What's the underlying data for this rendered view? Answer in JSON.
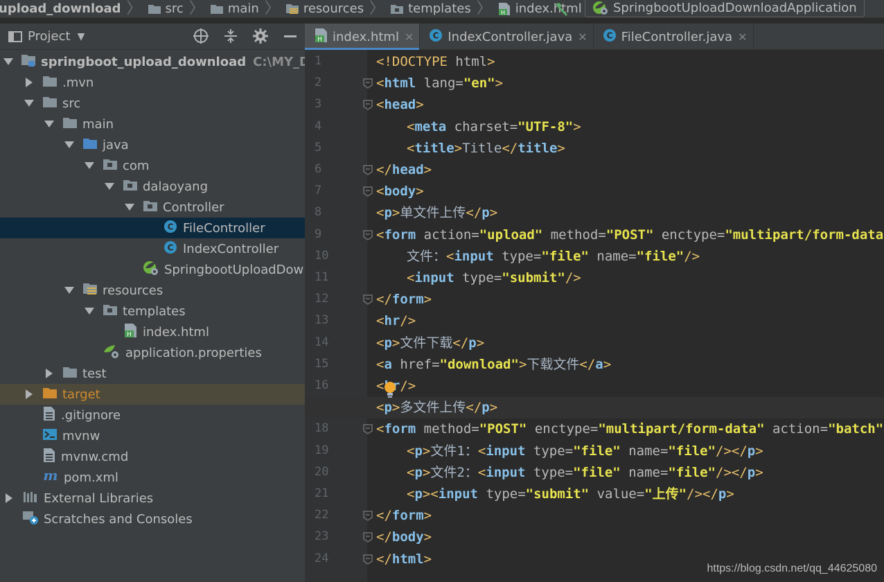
{
  "navbar": {
    "crumbs": [
      "upload_download",
      "src",
      "main",
      "resources",
      "templates",
      "index.html"
    ],
    "run_config": "SpringbootUploadDownloadApplication"
  },
  "project": {
    "title": "Project",
    "tree": [
      {
        "label": "springboot_upload_download",
        "hint": "C:\\MY_DA",
        "icon": "module-folder-icon",
        "arrow": "down"
      },
      {
        "label": ".mvn",
        "icon": "folder-icon",
        "arrow": "right"
      },
      {
        "label": "src",
        "icon": "folder-icon",
        "arrow": "down"
      },
      {
        "label": "main",
        "icon": "folder-icon",
        "arrow": "down"
      },
      {
        "label": "java",
        "icon": "source-folder-icon",
        "arrow": "down"
      },
      {
        "label": "com",
        "icon": "package-icon",
        "arrow": "down"
      },
      {
        "label": "dalaoyang",
        "icon": "package-icon",
        "arrow": "down"
      },
      {
        "label": "Controller",
        "icon": "package-icon",
        "arrow": "down"
      },
      {
        "label": "FileController",
        "icon": "class-icon",
        "selected": true
      },
      {
        "label": "IndexController",
        "icon": "class-icon"
      },
      {
        "label": "SpringbootUploadDow",
        "icon": "spring-boot-app-icon"
      },
      {
        "label": "resources",
        "icon": "resources-folder-icon",
        "arrow": "down"
      },
      {
        "label": "templates",
        "icon": "package-icon",
        "arrow": "down"
      },
      {
        "label": "index.html",
        "icon": "html-file-icon"
      },
      {
        "label": "application.properties",
        "icon": "spring-properties-icon"
      },
      {
        "label": "test",
        "icon": "folder-icon",
        "arrow": "right"
      },
      {
        "label": "target",
        "icon": "excluded-folder-icon",
        "arrow": "right",
        "excluded": true
      },
      {
        "label": ".gitignore",
        "icon": "text-file-icon"
      },
      {
        "label": "mvnw",
        "icon": "shell-script-icon"
      },
      {
        "label": "mvnw.cmd",
        "icon": "text-file-icon"
      },
      {
        "label": "pom.xml",
        "icon": "maven-icon"
      },
      {
        "label": "External Libraries",
        "icon": "libraries-icon",
        "arrow": "right"
      },
      {
        "label": "Scratches and Consoles",
        "icon": "scratches-icon"
      }
    ]
  },
  "tabs": [
    {
      "label": "index.html",
      "icon": "html-file-icon",
      "active": true
    },
    {
      "label": "IndexController.java",
      "icon": "class-icon"
    },
    {
      "label": "FileController.java",
      "icon": "class-icon"
    }
  ],
  "editor": {
    "current_line": 17,
    "lines": [
      {
        "n": "1",
        "tokens": [
          [
            "doctype",
            "<!DOCTYPE"
          ],
          [
            "attr",
            " html"
          ],
          [
            "doctype",
            ">"
          ]
        ]
      },
      {
        "n": "2",
        "fold": true,
        "tokens": [
          [
            "tag",
            "<"
          ],
          [
            "name",
            "html"
          ],
          [
            "attr",
            " lang="
          ],
          [
            "str",
            "\"en\""
          ],
          [
            "tag",
            ">"
          ]
        ]
      },
      {
        "n": "3",
        "fold": true,
        "tokens": [
          [
            "tag",
            "<"
          ],
          [
            "name",
            "head"
          ],
          [
            "tag",
            ">"
          ]
        ]
      },
      {
        "n": "4",
        "indent": 1,
        "tokens": [
          [
            "tag",
            "<"
          ],
          [
            "name",
            "meta"
          ],
          [
            "attr",
            " charset="
          ],
          [
            "str",
            "\"UTF-8\""
          ],
          [
            "tag",
            ">"
          ]
        ]
      },
      {
        "n": "5",
        "indent": 1,
        "tokens": [
          [
            "tag",
            "<"
          ],
          [
            "name",
            "title"
          ],
          [
            "tag",
            ">"
          ],
          [
            "text",
            "Title"
          ],
          [
            "tag",
            "</"
          ],
          [
            "name",
            "title"
          ],
          [
            "tag",
            ">"
          ]
        ]
      },
      {
        "n": "6",
        "fold": true,
        "tokens": [
          [
            "tag",
            "</"
          ],
          [
            "name",
            "head"
          ],
          [
            "tag",
            ">"
          ]
        ]
      },
      {
        "n": "7",
        "fold": true,
        "tokens": [
          [
            "tag",
            "<"
          ],
          [
            "name",
            "body"
          ],
          [
            "tag",
            ">"
          ]
        ]
      },
      {
        "n": "8",
        "tokens": [
          [
            "tag",
            "<"
          ],
          [
            "name",
            "p"
          ],
          [
            "tag",
            ">"
          ],
          [
            "text",
            "单文件上传"
          ],
          [
            "tag",
            "</"
          ],
          [
            "name",
            "p"
          ],
          [
            "tag",
            ">"
          ]
        ]
      },
      {
        "n": "9",
        "fold": true,
        "tokens": [
          [
            "tag",
            "<"
          ],
          [
            "name",
            "form"
          ],
          [
            "attr",
            " action="
          ],
          [
            "str",
            "\"upload\""
          ],
          [
            "attr",
            " method="
          ],
          [
            "str",
            "\"POST\""
          ],
          [
            "attr",
            " enctype="
          ],
          [
            "str",
            "\"multipart/form-data\""
          ],
          [
            "tag",
            ">"
          ]
        ]
      },
      {
        "n": "10",
        "indent": 1,
        "tokens": [
          [
            "text",
            "文件："
          ],
          [
            "tag",
            "<"
          ],
          [
            "name",
            "input"
          ],
          [
            "attr",
            " type="
          ],
          [
            "str",
            "\"file\""
          ],
          [
            "attr",
            " name="
          ],
          [
            "str",
            "\"file\""
          ],
          [
            "tag",
            "/>"
          ]
        ]
      },
      {
        "n": "11",
        "indent": 1,
        "tokens": [
          [
            "tag",
            "<"
          ],
          [
            "name",
            "input"
          ],
          [
            "attr",
            " type="
          ],
          [
            "str",
            "\"submit\""
          ],
          [
            "tag",
            "/>"
          ]
        ]
      },
      {
        "n": "12",
        "fold": true,
        "tokens": [
          [
            "tag",
            "</"
          ],
          [
            "name",
            "form"
          ],
          [
            "tag",
            ">"
          ]
        ]
      },
      {
        "n": "13",
        "tokens": [
          [
            "tag",
            "<"
          ],
          [
            "name",
            "hr"
          ],
          [
            "tag",
            "/>"
          ]
        ]
      },
      {
        "n": "14",
        "tokens": [
          [
            "tag",
            "<"
          ],
          [
            "name",
            "p"
          ],
          [
            "tag",
            ">"
          ],
          [
            "text",
            "文件下载"
          ],
          [
            "tag",
            "</"
          ],
          [
            "name",
            "p"
          ],
          [
            "tag",
            ">"
          ]
        ]
      },
      {
        "n": "15",
        "tokens": [
          [
            "tag",
            "<"
          ],
          [
            "name",
            "a"
          ],
          [
            "attr",
            " href="
          ],
          [
            "str",
            "\"download\""
          ],
          [
            "tag",
            ">"
          ],
          [
            "text",
            "下载文件"
          ],
          [
            "tag",
            "</"
          ],
          [
            "name",
            "a"
          ],
          [
            "tag",
            ">"
          ]
        ]
      },
      {
        "n": "16",
        "tokens": [
          [
            "tag",
            "<"
          ],
          [
            "name",
            "hr"
          ],
          [
            "tag",
            "/>"
          ]
        ]
      },
      {
        "n": "",
        "tokens": [
          [
            "tag",
            "<"
          ],
          [
            "name",
            "p"
          ],
          [
            "tag",
            ">"
          ],
          [
            "text",
            "多文件上传"
          ],
          [
            "tag",
            "</"
          ],
          [
            "name",
            "p"
          ],
          [
            "tag",
            ">"
          ]
        ]
      },
      {
        "n": "18",
        "fold": true,
        "tokens": [
          [
            "tag",
            "<"
          ],
          [
            "name",
            "form"
          ],
          [
            "attr",
            " method="
          ],
          [
            "str",
            "\"POST\""
          ],
          [
            "attr",
            " enctype="
          ],
          [
            "str",
            "\"multipart/form-data\""
          ],
          [
            "attr",
            " action="
          ],
          [
            "str",
            "\"batch\""
          ],
          [
            "tag",
            ">"
          ]
        ]
      },
      {
        "n": "19",
        "indent": 1,
        "tokens": [
          [
            "tag",
            "<"
          ],
          [
            "name",
            "p"
          ],
          [
            "tag",
            ">"
          ],
          [
            "text",
            "文件1："
          ],
          [
            "tag",
            "<"
          ],
          [
            "name",
            "input"
          ],
          [
            "attr",
            " type="
          ],
          [
            "str",
            "\"file\""
          ],
          [
            "attr",
            " name="
          ],
          [
            "str",
            "\"file\""
          ],
          [
            "tag",
            "/></"
          ],
          [
            "name",
            "p"
          ],
          [
            "tag",
            ">"
          ]
        ]
      },
      {
        "n": "20",
        "indent": 1,
        "tokens": [
          [
            "tag",
            "<"
          ],
          [
            "name",
            "p"
          ],
          [
            "tag",
            ">"
          ],
          [
            "text",
            "文件2："
          ],
          [
            "tag",
            "<"
          ],
          [
            "name",
            "input"
          ],
          [
            "attr",
            " type="
          ],
          [
            "str",
            "\"file\""
          ],
          [
            "attr",
            " name="
          ],
          [
            "str",
            "\"file\""
          ],
          [
            "tag",
            "/></"
          ],
          [
            "name",
            "p"
          ],
          [
            "tag",
            ">"
          ]
        ]
      },
      {
        "n": "21",
        "indent": 1,
        "tokens": [
          [
            "tag",
            "<"
          ],
          [
            "name",
            "p"
          ],
          [
            "tag",
            "><"
          ],
          [
            "name",
            "input"
          ],
          [
            "attr",
            " type="
          ],
          [
            "str",
            "\"submit\""
          ],
          [
            "attr",
            " value="
          ],
          [
            "str",
            "\"上传\""
          ],
          [
            "tag",
            "/></"
          ],
          [
            "name",
            "p"
          ],
          [
            "tag",
            ">"
          ]
        ]
      },
      {
        "n": "22",
        "fold": true,
        "tokens": [
          [
            "tag",
            "</"
          ],
          [
            "name",
            "form"
          ],
          [
            "tag",
            ">"
          ]
        ]
      },
      {
        "n": "23",
        "fold": true,
        "tokens": [
          [
            "tag",
            "</"
          ],
          [
            "name",
            "body"
          ],
          [
            "tag",
            ">"
          ]
        ]
      },
      {
        "n": "24",
        "fold": true,
        "tokens": [
          [
            "tag",
            "</"
          ],
          [
            "name",
            "html"
          ],
          [
            "tag",
            ">"
          ]
        ]
      }
    ]
  },
  "watermark": "https://blog.csdn.net/qq_44625080"
}
